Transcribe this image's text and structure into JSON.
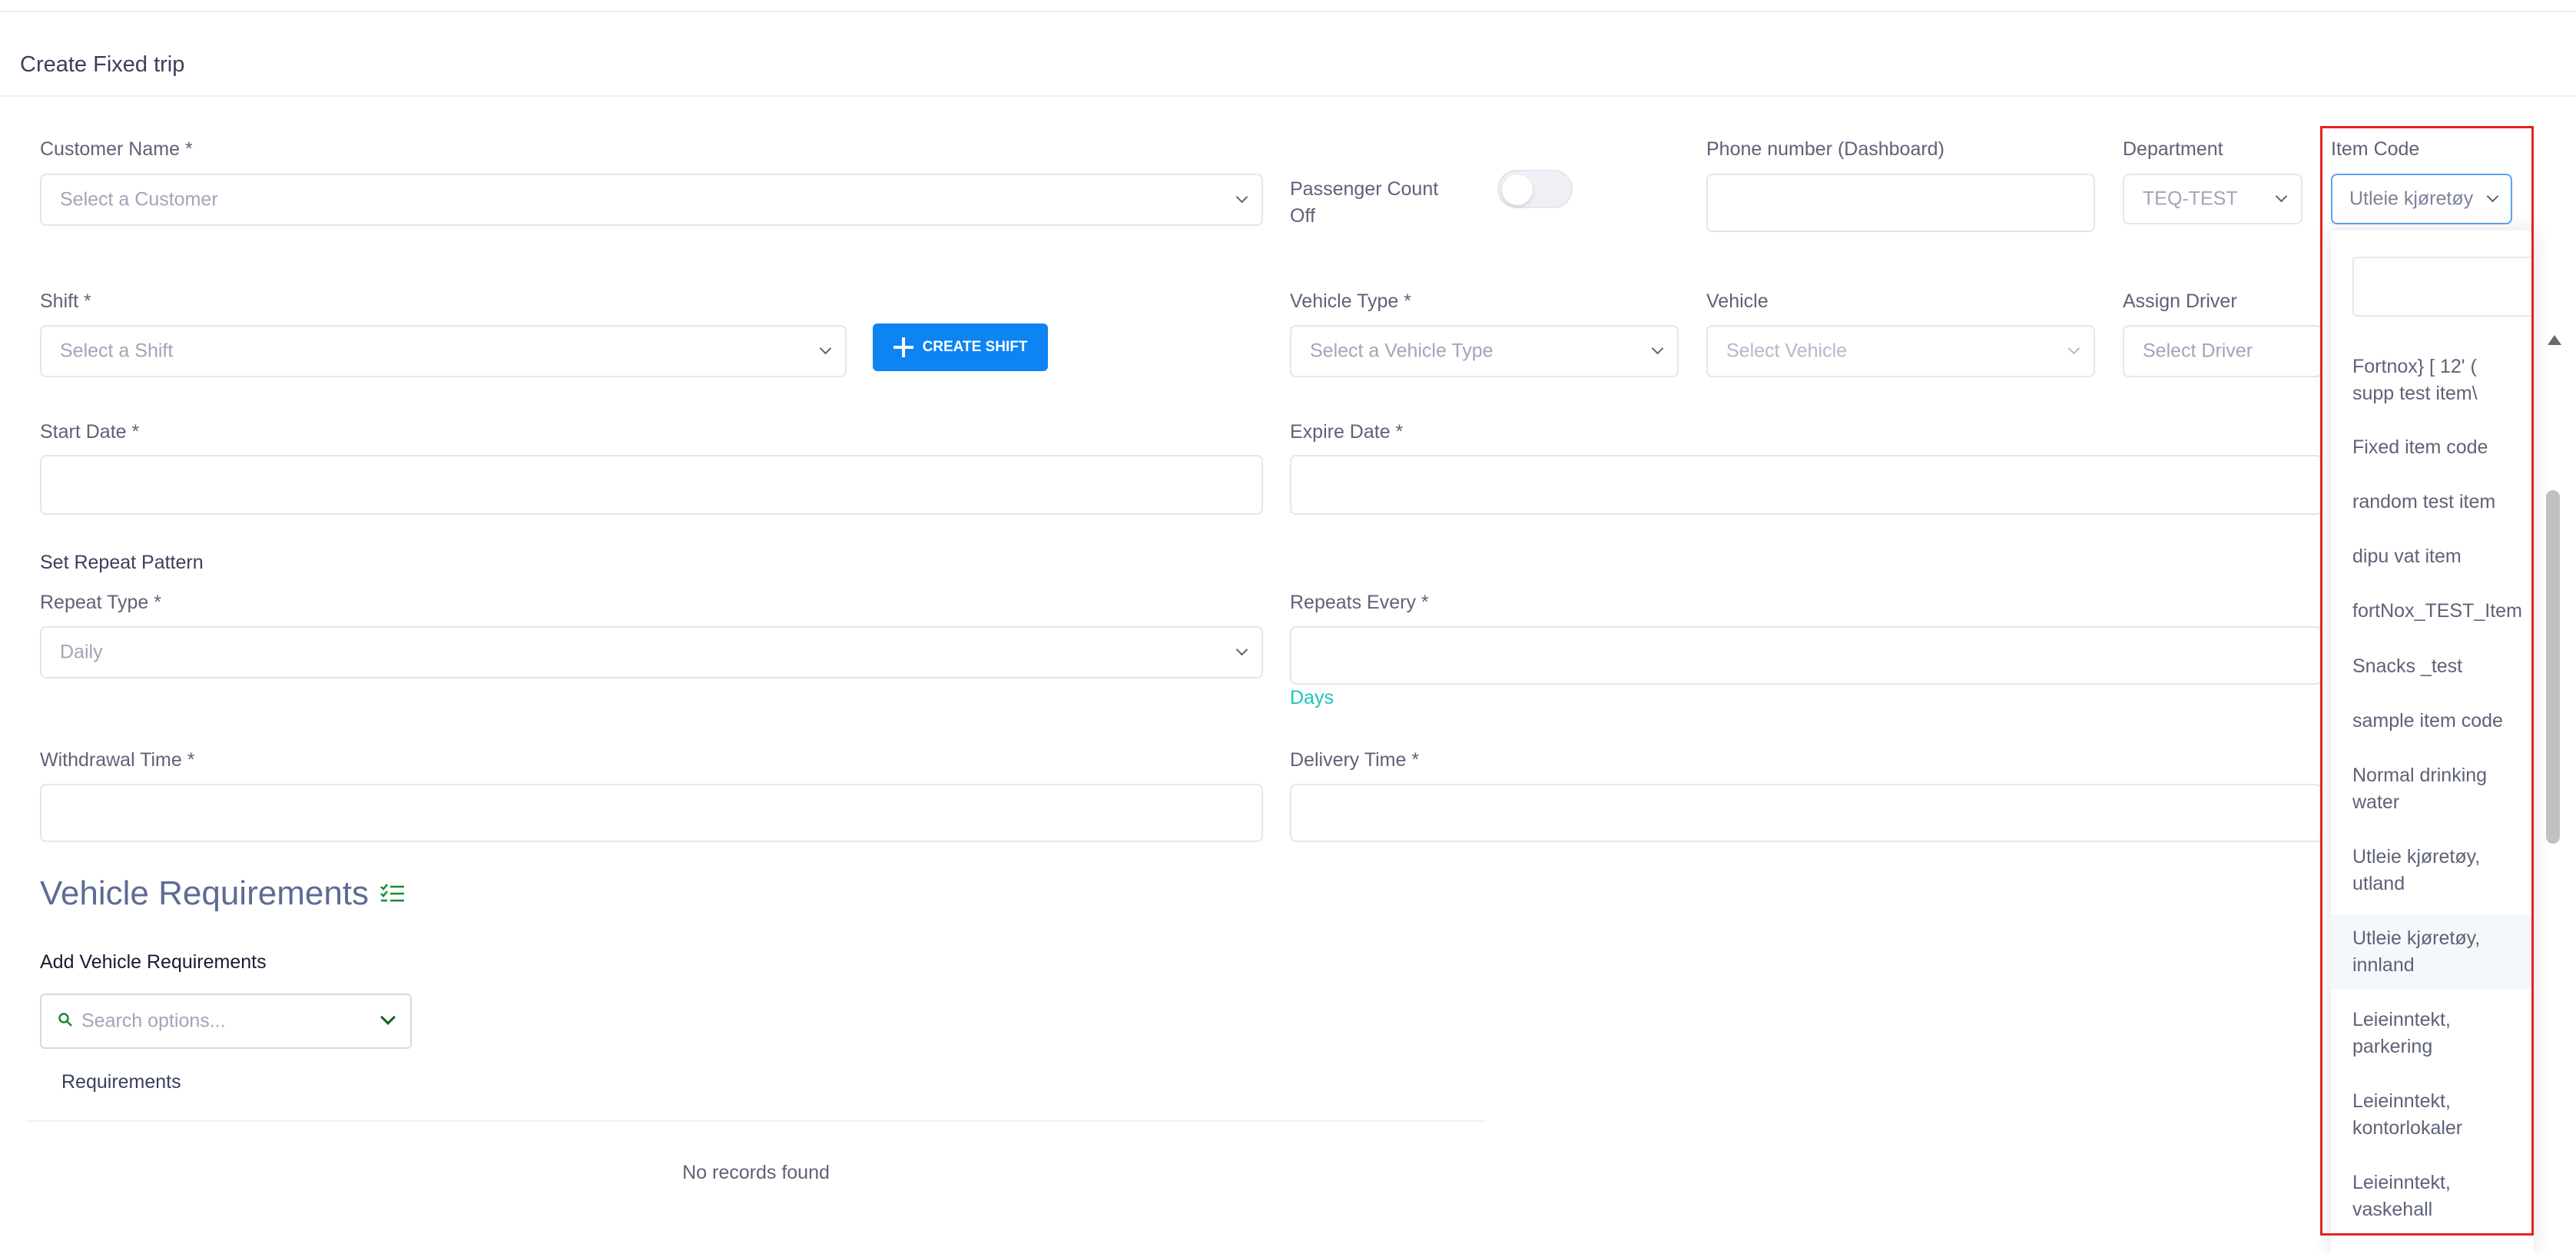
{
  "page": {
    "title": "Create Fixed trip"
  },
  "form": {
    "customer_name": {
      "label": "Customer Name *",
      "placeholder": "Select a Customer"
    },
    "passenger_count": {
      "label_line1": "Passenger Count",
      "label_line2": "Off"
    },
    "phone": {
      "label": "Phone number (Dashboard)",
      "value": ""
    },
    "department": {
      "label": "Department",
      "value": "TEQ-TEST"
    },
    "item_code": {
      "label": "Item Code",
      "value": "Utleie kjøretøy"
    },
    "shift": {
      "label": "Shift *",
      "placeholder": "Select a Shift",
      "create_button": "CREATE SHIFT"
    },
    "vehicle_type": {
      "label": "Vehicle Type *",
      "placeholder": "Select a Vehicle Type"
    },
    "vehicle": {
      "label": "Vehicle",
      "placeholder": "Select Vehicle"
    },
    "assign_driver": {
      "label": "Assign Driver",
      "placeholder": "Select Driver"
    },
    "start_date": {
      "label": "Start Date *",
      "value": ""
    },
    "expire_date": {
      "label": "Expire Date *",
      "value": ""
    },
    "repeat_pattern": {
      "heading": "Set Repeat Pattern"
    },
    "repeat_type": {
      "label": "Repeat Type *",
      "value": "Daily"
    },
    "repeats_every": {
      "label": "Repeats Every *",
      "value": "",
      "hint": "Days"
    },
    "withdrawal_time": {
      "label": "Withdrawal Time *",
      "value": ""
    },
    "delivery_time": {
      "label": "Delivery Time *",
      "value": ""
    }
  },
  "vehicle_requirements": {
    "title": "Vehicle Requirements",
    "add_label": "Add Vehicle Requirements",
    "search_placeholder": "Search options...",
    "table_header": "Requirements",
    "empty_text": "No records found"
  },
  "item_code_dropdown": {
    "search_value": "",
    "items": [
      {
        "line1": "Fortnox} [ 12' (",
        "line2": "supp test item\\"
      },
      {
        "line1": "Fixed item code",
        "line2": ""
      },
      {
        "line1": "random test item",
        "line2": ""
      },
      {
        "line1": "dipu vat item",
        "line2": ""
      },
      {
        "line1": "fortNox_TEST_Item",
        "line2": ""
      },
      {
        "line1": "Snacks _test",
        "line2": ""
      },
      {
        "line1": "sample item code",
        "line2": ""
      },
      {
        "line1": "Normal drinking",
        "line2": "water"
      },
      {
        "line1": "Utleie kjøretøy,",
        "line2": "utland"
      },
      {
        "line1": "Utleie kjøretøy,",
        "line2": "innland"
      },
      {
        "line1": "Leieinntekt,",
        "line2": "parkering"
      },
      {
        "line1": "Leieinntekt,",
        "line2": "kontorlokaler"
      },
      {
        "line1": "Leieinntekt,",
        "line2": "vaskehall"
      }
    ]
  },
  "colors": {
    "primary": "#0d84f2",
    "hint_teal": "#1bc5bd",
    "highlight_red": "#e02424",
    "section_title": "#5e6b93"
  }
}
